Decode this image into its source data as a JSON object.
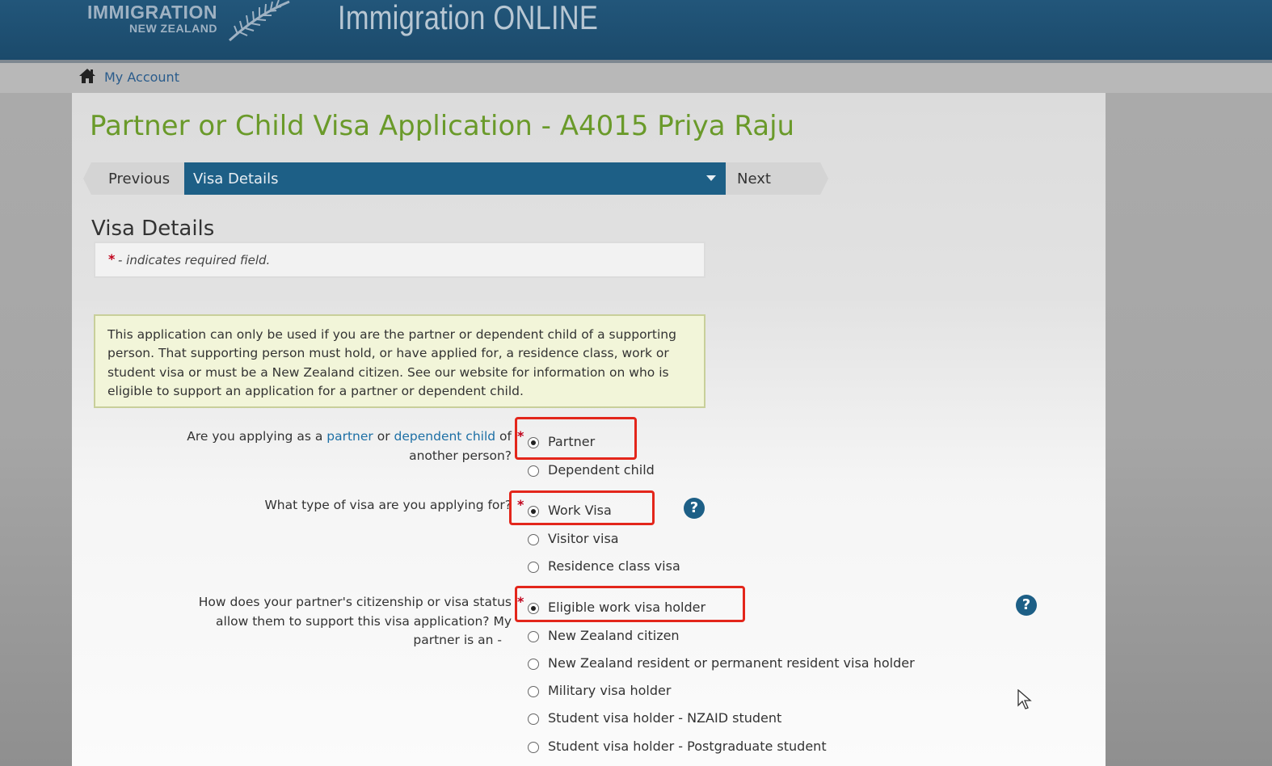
{
  "header": {
    "logo_line1": "IMMIGRATION",
    "logo_line2": "NEW ZEALAND",
    "app_title": "Immigration ONLINE"
  },
  "account_bar": {
    "my_account": "My Account"
  },
  "page": {
    "title": "Partner or Child Visa Application - A4015 Priya Raju"
  },
  "nav": {
    "previous": "Previous",
    "current_section": "Visa Details",
    "next": "Next"
  },
  "section": {
    "heading": "Visa Details",
    "required_star": "*",
    "required_note": "- indicates required field."
  },
  "info_text": "This application can only be used if you are the partner or dependent child of a supporting person. That supporting person must hold, or have applied for, a residence class, work or student visa or must be a New Zealand citizen. See our website for information on who is eligible to support an application for a partner or dependent child.",
  "questions": {
    "q1": {
      "pre": "Are you applying as a",
      "link1": "partner",
      "mid": "or",
      "link2": "dependent child",
      "post_line1": "of",
      "post_line2": "another person?",
      "options": [
        "Partner",
        "Dependent child"
      ],
      "selected": "Partner"
    },
    "q2": {
      "label": "What type of visa are you applying for?",
      "options": [
        "Work Visa",
        "Visitor visa",
        "Residence class visa"
      ],
      "selected": "Work Visa"
    },
    "q3": {
      "line1": "How does your partner's citizenship or visa status",
      "line2": "allow them to support this visa application? My",
      "line3": "partner is an -",
      "options": [
        "Eligible work visa holder",
        "New Zealand citizen",
        "New Zealand resident or permanent resident visa holder",
        "Military visa holder",
        "Student visa holder - NZAID student",
        "Student visa holder - Postgraduate student"
      ],
      "selected": "Eligible work visa holder"
    }
  },
  "help_symbol": "?",
  "colors": {
    "header_bg": "#1b4a6b",
    "title_green": "#6a9a2a",
    "nav_blue": "#1d5f86",
    "highlight_red": "#e3261b",
    "info_bg": "#f2f5d9"
  }
}
